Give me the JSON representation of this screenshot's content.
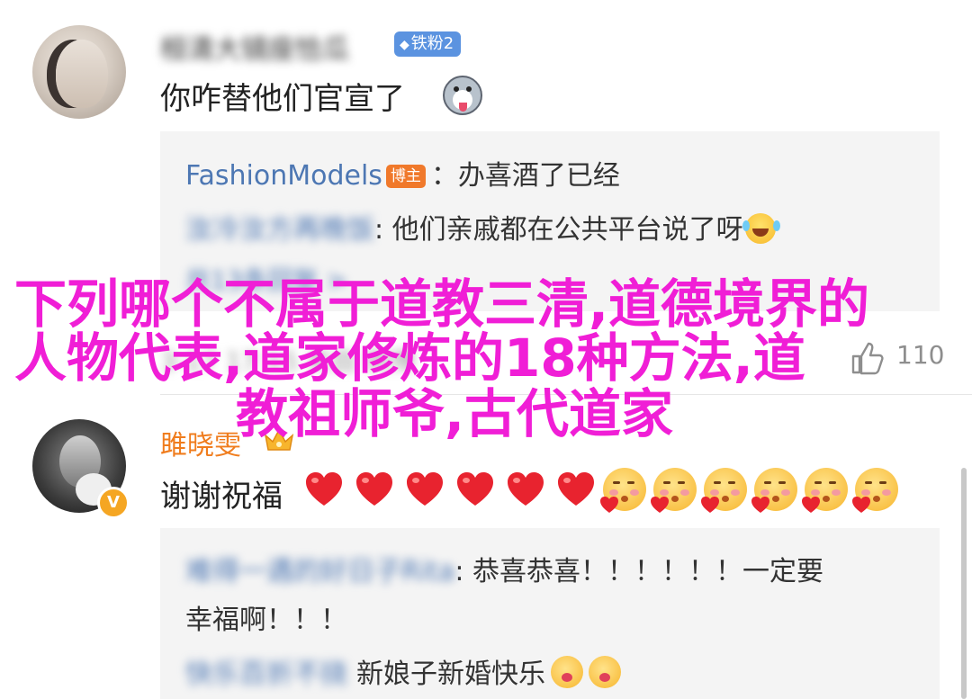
{
  "comment1": {
    "username": "桓清大镜座恰瓜",
    "badge_label": "铁粉2",
    "text": "你咋替他们官宣了",
    "emoji_icon": "dog-face-icon"
  },
  "reply_box1": {
    "reply1": {
      "name": "FashionModels",
      "badge": "博主",
      "text": "：办喜酒了已经"
    },
    "reply2": {
      "name": "汝冷汝方再晚饭",
      "text": ": 他们亲戚都在公共平台说了呀",
      "emoji_icon": "laughing-tears-icon"
    },
    "more_replies": "共13条回复 >"
  },
  "meta": {
    "time": "3-17 17:15 来自 微博",
    "like_count": "110"
  },
  "overlay": {
    "line1": "下列哪个不属于道教三清,道德境界的",
    "line2": "人物代表,道家修炼的18种方法,道",
    "line3": "教祖师爷,古代道家"
  },
  "comment2": {
    "username": "雎晓雯",
    "text": "谢谢祝福",
    "hearts_count": 6,
    "kiss_faces_count": 6
  },
  "reply_box2": {
    "reply1": {
      "name": "难得一遇的好日子Rita",
      "text": ": 恭喜恭喜！！！！！！一定要",
      "text_cont": "幸福啊！！！"
    },
    "reply2": {
      "name": "快乐百折不挠",
      "text": "新娘子新婚快乐"
    }
  },
  "colors": {
    "overlay_magenta": "#f01ed6",
    "link_blue": "#4d77b3",
    "username_orange": "#f07d1e",
    "heart_red": "#e8232f"
  }
}
